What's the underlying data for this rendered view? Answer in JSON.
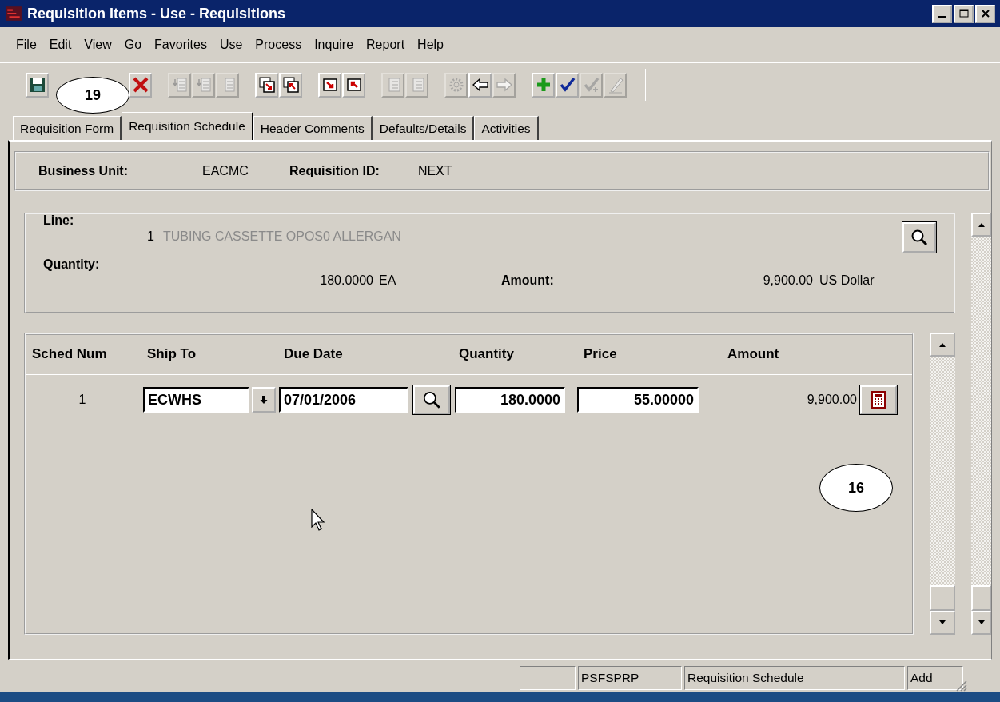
{
  "window": {
    "title": "Requisition Items - Use - Requisitions"
  },
  "menu": [
    {
      "label": "File"
    },
    {
      "label": "Edit"
    },
    {
      "label": "View"
    },
    {
      "label": "Go"
    },
    {
      "label": "Favorites"
    },
    {
      "label": "Use"
    },
    {
      "label": "Process"
    },
    {
      "label": "Inquire"
    },
    {
      "label": "Report"
    },
    {
      "label": "Help"
    }
  ],
  "toolbar": [
    [
      {
        "disabled": false
      },
      {
        "disabled": false
      }
    ],
    [
      {
        "disabled": true
      },
      {
        "disabled": true
      },
      {
        "disabled": true
      }
    ],
    [
      {
        "disabled": false
      },
      {
        "disabled": false
      }
    ],
    [
      {
        "disabled": false
      },
      {
        "disabled": false
      }
    ],
    [
      {
        "disabled": true
      },
      {
        "disabled": true
      }
    ],
    [
      {
        "disabled": true
      },
      {
        "disabled": false
      },
      {
        "disabled": true
      }
    ],
    [
      {
        "disabled": false
      },
      {
        "disabled": false
      },
      {
        "disabled": true
      },
      {
        "disabled": true
      }
    ]
  ],
  "tabs": [
    {
      "label": "Requisition Form",
      "selected": false
    },
    {
      "label": "Requisition Schedule",
      "selected": true
    },
    {
      "label": "Header Comments",
      "selected": false
    },
    {
      "label": "Defaults/Details",
      "selected": false
    },
    {
      "label": "Activities",
      "selected": false
    }
  ],
  "header": {
    "business_unit_label": "Business Unit:",
    "business_unit": "EACMC",
    "requisition_id_label": "Requisition ID:",
    "requisition_id": "NEXT"
  },
  "line": {
    "line_label": "Line:",
    "line_number": "1",
    "description": "TUBING CASSETTE OPOS0 ALLERGAN",
    "description_disabled": true,
    "quantity_label": "Quantity:",
    "quantity": "180.0000",
    "unit": "EA",
    "amount_label": "Amount:",
    "amount": "9,900.00",
    "currency": "US Dollar"
  },
  "schedule": {
    "columns": [
      "Sched Num",
      "Ship To",
      "Due Date",
      "Quantity",
      "Price",
      "Amount"
    ],
    "rows": [
      {
        "sched_num": "1",
        "ship_to": "ECWHS",
        "due_date": "07/01/2006",
        "quantity": "180.0000",
        "price": "55.00000",
        "amount": "9,900.00"
      }
    ]
  },
  "callouts": [
    "19",
    "16"
  ],
  "status_bar": [
    "PSFSPRP",
    "Requisition Schedule",
    "Add"
  ]
}
